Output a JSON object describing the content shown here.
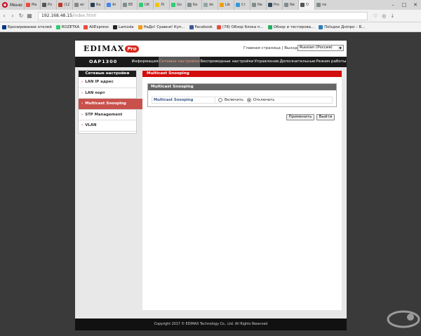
{
  "browser": {
    "menu_label": "Меню",
    "tabs": [
      {
        "label": "Ма",
        "color": "#e74c3c"
      },
      {
        "label": "Ро",
        "color": "#555555"
      },
      {
        "label": "(12",
        "color": "#c0392b"
      },
      {
        "label": "wr",
        "color": "#888888"
      },
      {
        "label": "Ra",
        "color": "#2c3e50"
      },
      {
        "label": "Ar",
        "color": "#4285f4"
      },
      {
        "label": "EE",
        "color": "#7f8c8d"
      },
      {
        "label": "UK",
        "color": "#2ecc71"
      },
      {
        "label": "Лі",
        "color": "#f1c40f"
      },
      {
        "label": "Go",
        "color": "#2ecc71"
      },
      {
        "label": "Бе",
        "color": "#7f8c8d"
      },
      {
        "label": "do",
        "color": "#95a5a6"
      },
      {
        "label": "Lik",
        "color": "#f39c12"
      },
      {
        "label": "Cr",
        "color": "#3498db"
      },
      {
        "label": "Ne",
        "color": "#7f8c8d"
      },
      {
        "label": "Pro",
        "color": "#34495e"
      },
      {
        "label": "Ne",
        "color": "#7f8c8d"
      },
      {
        "label": "O",
        "color": "#555555",
        "active": true
      },
      {
        "label": "ne",
        "color": "#7f8c8d"
      }
    ],
    "url_host": "192.168.48.15",
    "url_path": "/index.html",
    "bookmarks": [
      {
        "label": "Бронирование отелей",
        "color": "#003580"
      },
      {
        "label": "ROZETKA",
        "color": "#2ecc71"
      },
      {
        "label": "AliExpress",
        "color": "#e74c3c"
      },
      {
        "label": "Lamoda",
        "color": "#222222"
      },
      {
        "label": "НаДо! Сравни! Куп...",
        "color": "#f39c12"
      },
      {
        "label": "Facebook",
        "color": "#3b5998"
      },
      {
        "label": "(78) Обзор блока п...",
        "color": "#e74c3c"
      },
      {
        "label": "Обзор и тестирова...",
        "color": "#27ae60"
      },
      {
        "label": "Поїздки Дніпро – Б...",
        "color": "#2980b9"
      }
    ]
  },
  "router": {
    "logo_text": "EDIMAX",
    "logo_pro": "Pro",
    "header_links": "Главная страница | Выход",
    "language": "Russian (Россия)",
    "model": "OAP1300",
    "nav_tabs": [
      {
        "label": "Информация",
        "active": false
      },
      {
        "label": "Сетевые настройки",
        "active": true
      },
      {
        "label": "Беспроводные настройки",
        "active": false
      },
      {
        "label": "Управление",
        "active": false
      },
      {
        "label": "Дополнительные",
        "active": false
      },
      {
        "label": "Режим работы",
        "active": false
      }
    ],
    "sidebar": {
      "title": "Сетевые настройки",
      "items": [
        {
          "label": "LAN IP адрес",
          "active": false
        },
        {
          "label": "LAN порт",
          "active": false
        },
        {
          "label": "Multicast Snooping",
          "active": true
        },
        {
          "label": "STP Management",
          "active": false
        },
        {
          "label": "VLAN",
          "active": false
        }
      ]
    },
    "section_title": "Multicast Snooping",
    "panel_title": "Multicast Snooping",
    "row_label": "Multicast Snooping",
    "radio_on": "Включить",
    "radio_off": "Отключить",
    "selected": "off",
    "apply_button": "Применить",
    "exit_button": "Выйти",
    "footer": "Copyright 2017 © EDIMAX Technology Co., Ltd. All Rights Reserved"
  }
}
